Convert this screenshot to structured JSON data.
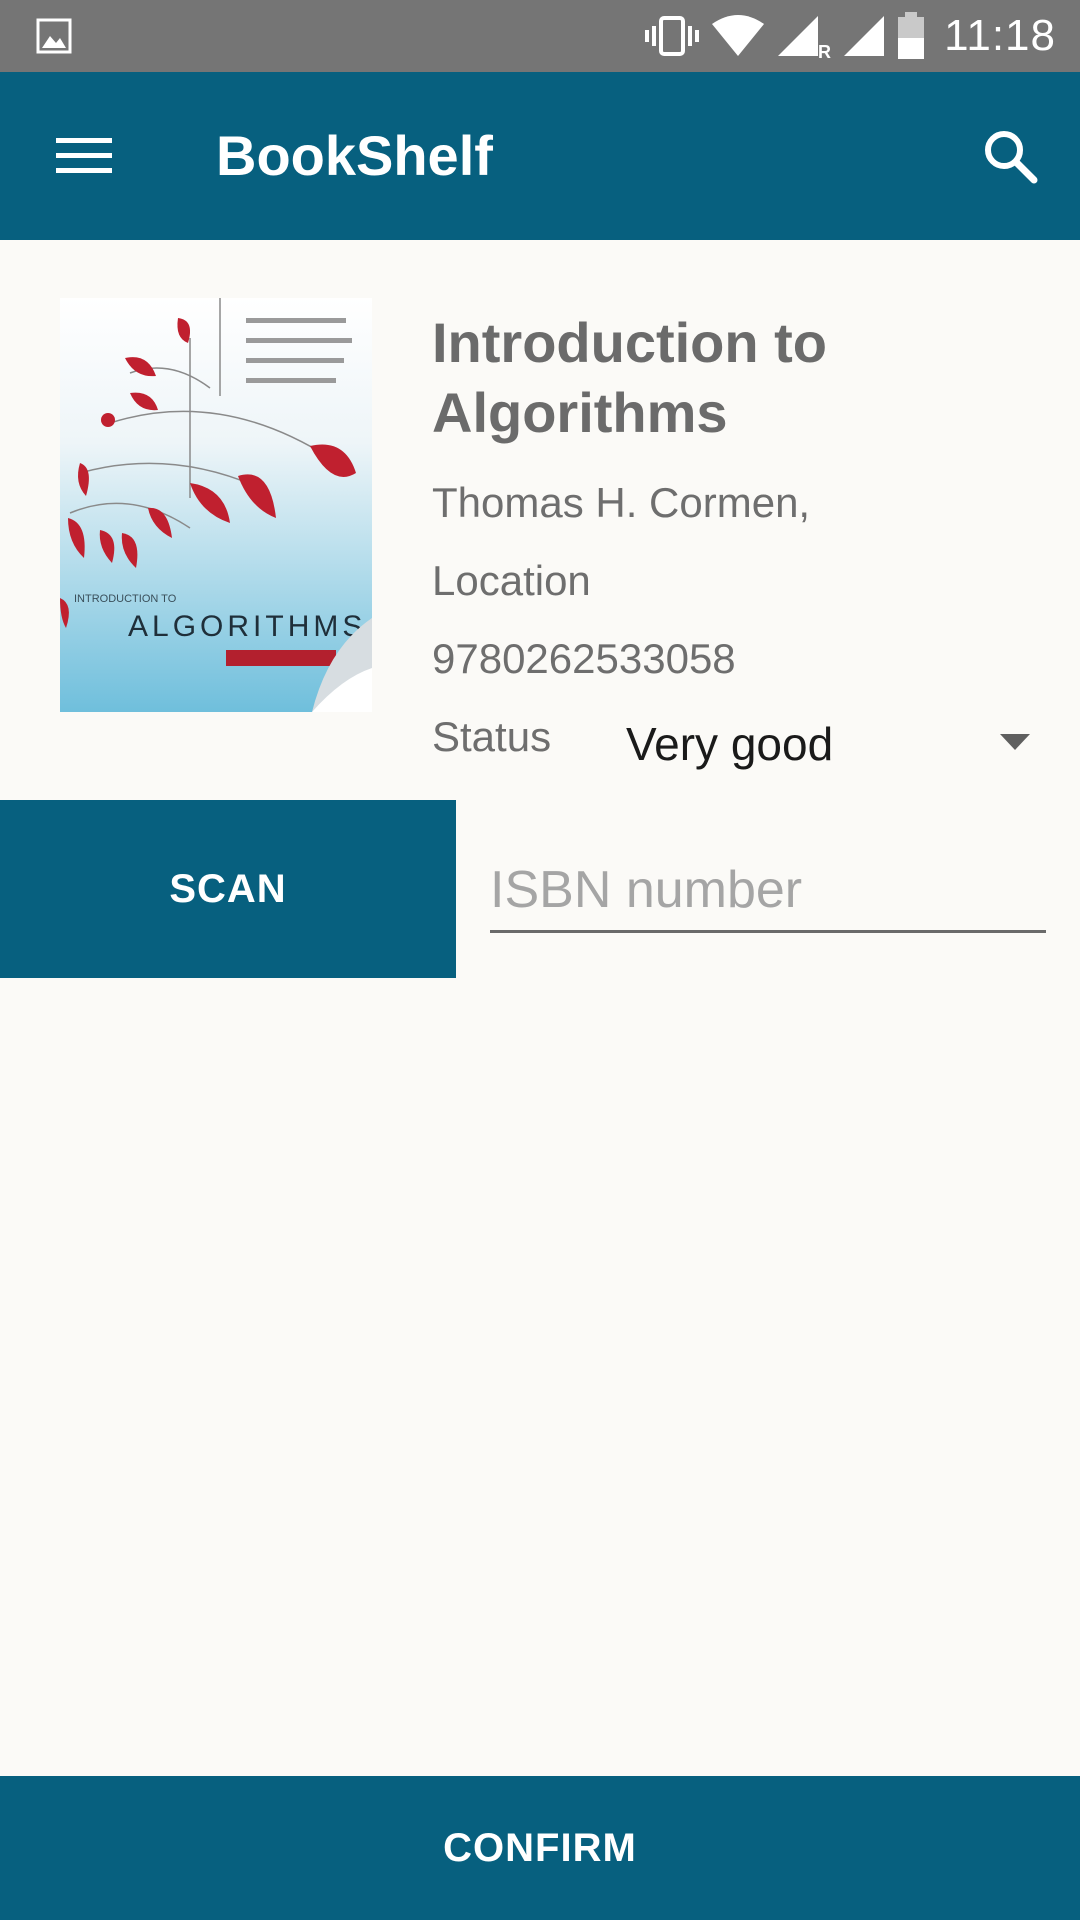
{
  "status_bar": {
    "time": "11:18",
    "icons": [
      "gallery-icon",
      "vibrate-icon",
      "wifi-icon",
      "signal-roaming-icon",
      "signal-icon",
      "battery-icon"
    ]
  },
  "app_bar": {
    "title": "BookShelf",
    "menu_icon": "menu-icon",
    "search_icon": "search-icon"
  },
  "book": {
    "cover_title": "ALGORITHMS",
    "cover_subtitle": "INTRODUCTION TO",
    "title": "Introduction to Algorithms",
    "author": "Thomas H. Cormen,",
    "location": "Location",
    "isbn": "9780262533058",
    "status_label": "Status",
    "status_value": "Very good"
  },
  "actions": {
    "scan_label": "SCAN",
    "isbn_placeholder": "ISBN number",
    "isbn_value": "",
    "confirm_label": "CONFIRM"
  },
  "colors": {
    "primary": "#07607f",
    "status_bar": "#757575",
    "background": "#fbfaf7"
  }
}
